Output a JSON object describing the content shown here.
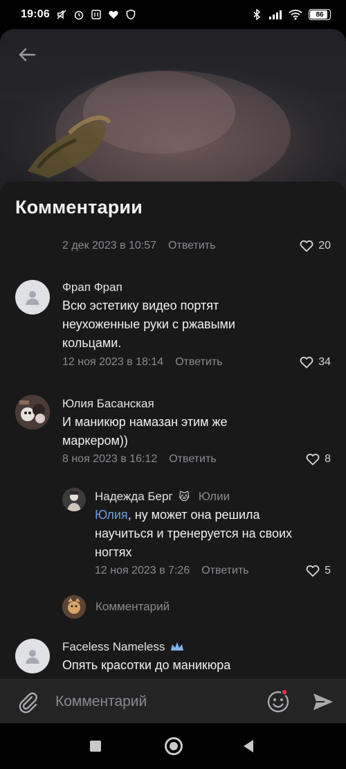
{
  "status_bar": {
    "time": "19:06",
    "battery": "86"
  },
  "sheet": {
    "title": "Комментарии"
  },
  "comments": [
    {
      "date": "2 дек 2023 в 10:57",
      "reply_label": "Ответить",
      "likes": "20"
    },
    {
      "author": "Фрап Фрап",
      "text_lines": [
        "Всю эстетику видео портят",
        "неухоженные руки с ржавыми",
        "кольцами."
      ],
      "date": "12 ноя 2023 в 18:14",
      "reply_label": "Ответить",
      "likes": "34"
    },
    {
      "author": "Юлия Басанская",
      "text_lines": [
        "И маникюр намазан этим же",
        "маркером))"
      ],
      "date": "8 ноя 2023 в 16:12",
      "reply_label": "Ответить",
      "likes": "8"
    },
    {
      "author": "Надежда Берг",
      "reply_to": "Юлии",
      "mention": "Юлия",
      "text_first": ", ну может она решила",
      "text_lines": [
        "научиться и тренеруется на своих",
        "ногтях"
      ],
      "date": "12 ноя 2023 в 7:26",
      "reply_label": "Ответить",
      "likes": "5"
    },
    {
      "author": "Faceless Nameless",
      "text_lines": [
        "Опять красотки до маникюра"
      ]
    }
  ],
  "thread_reply_placeholder": "Комментарий",
  "composer": {
    "placeholder": "Комментарий"
  },
  "colors": {
    "sheet_bg": "#19191a",
    "secondary_text": "#8a8b8f",
    "mention": "#6f9ee0",
    "notification_dot": "#ff3347"
  }
}
